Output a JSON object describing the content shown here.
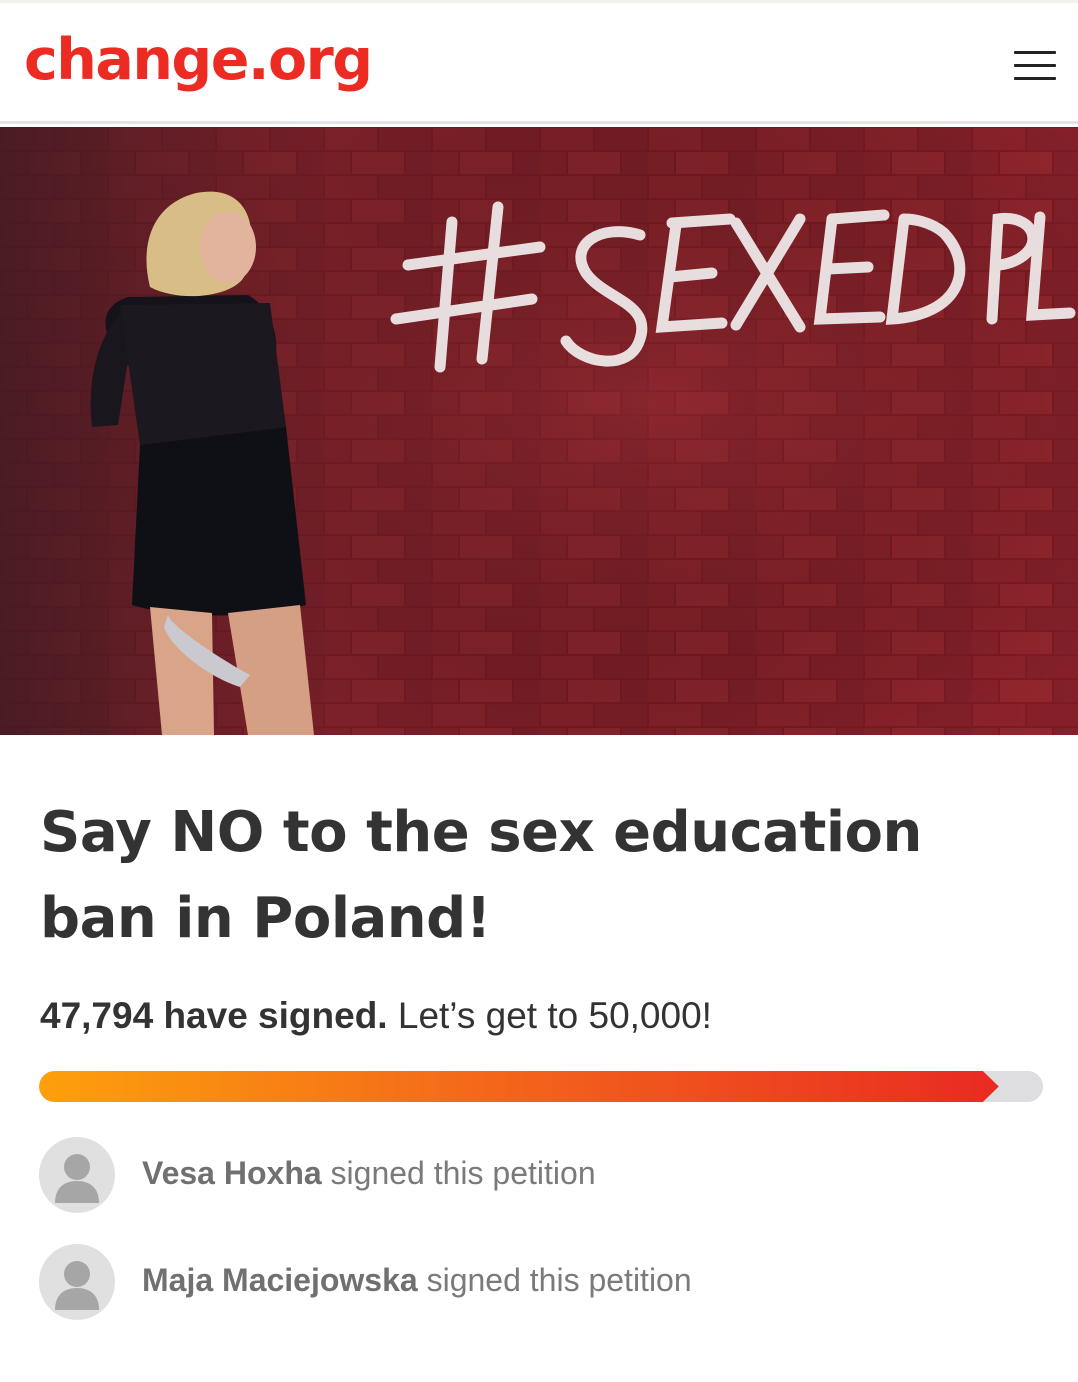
{
  "header": {
    "logo_text": "change.org",
    "menu_icon": "hamburger-menu-icon",
    "brand_color": "#ec2c22"
  },
  "hero": {
    "graffiti_text": "#SEXEDPL"
  },
  "petition": {
    "title": "Say NO to the sex education ban in Poland!",
    "signature_count": "47,794 have signed.",
    "goal_text": "Let’s get to 50,000!",
    "progress_fraction": 0.956
  },
  "signers": [
    {
      "name": "Vesa Hoxha",
      "action": "signed this petition",
      "avatar_icon": "user-avatar-icon"
    },
    {
      "name": "Maja Maciejowska",
      "action": "signed this petition",
      "avatar_icon": "user-avatar-icon"
    }
  ]
}
